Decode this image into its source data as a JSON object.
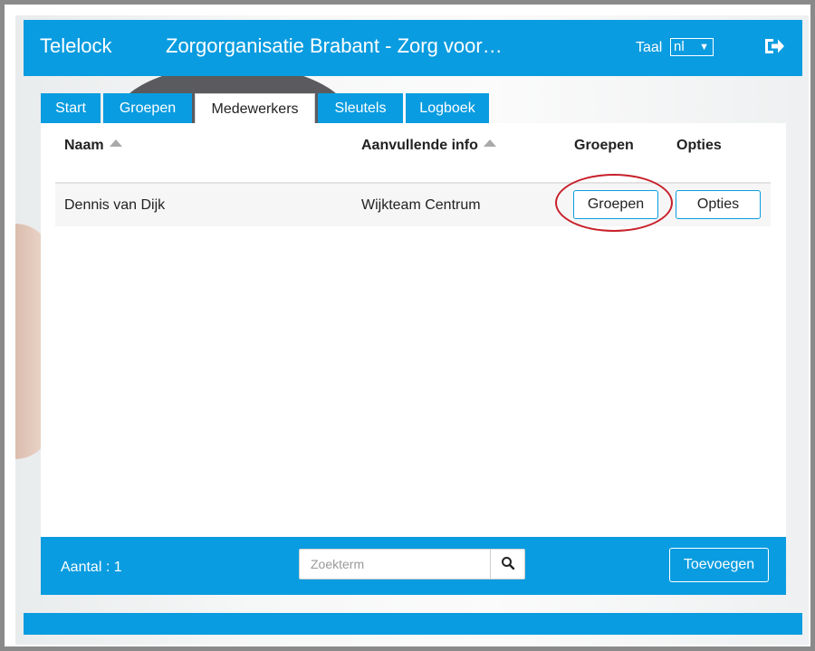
{
  "header": {
    "brand": "Telelock",
    "org_title": "Zorgorganisatie Brabant - Zorg voor…",
    "language_label": "Taal",
    "language_value": "nl",
    "logout_icon": "sign-out-icon",
    "brand_color": "#0a9ce0"
  },
  "tabs": [
    {
      "label": "Start",
      "active": false
    },
    {
      "label": "Groepen",
      "active": false
    },
    {
      "label": "Medewerkers",
      "active": true
    },
    {
      "label": "Sleutels",
      "active": false
    },
    {
      "label": "Logboek",
      "active": false
    }
  ],
  "table": {
    "columns": [
      "Naam",
      "Aanvullende info",
      "Groepen",
      "Opties"
    ],
    "rows": [
      {
        "naam": "Dennis van Dijk",
        "info": "Wijkteam Centrum",
        "groepen_button": "Groepen",
        "opties_button": "Opties"
      }
    ]
  },
  "footer": {
    "count": "Aantal : 1",
    "search_placeholder": "Zoekterm",
    "search_icon": "search-icon",
    "add_button": "Toevoegen"
  },
  "annotation": {
    "highlight_color": "#c8202a"
  }
}
